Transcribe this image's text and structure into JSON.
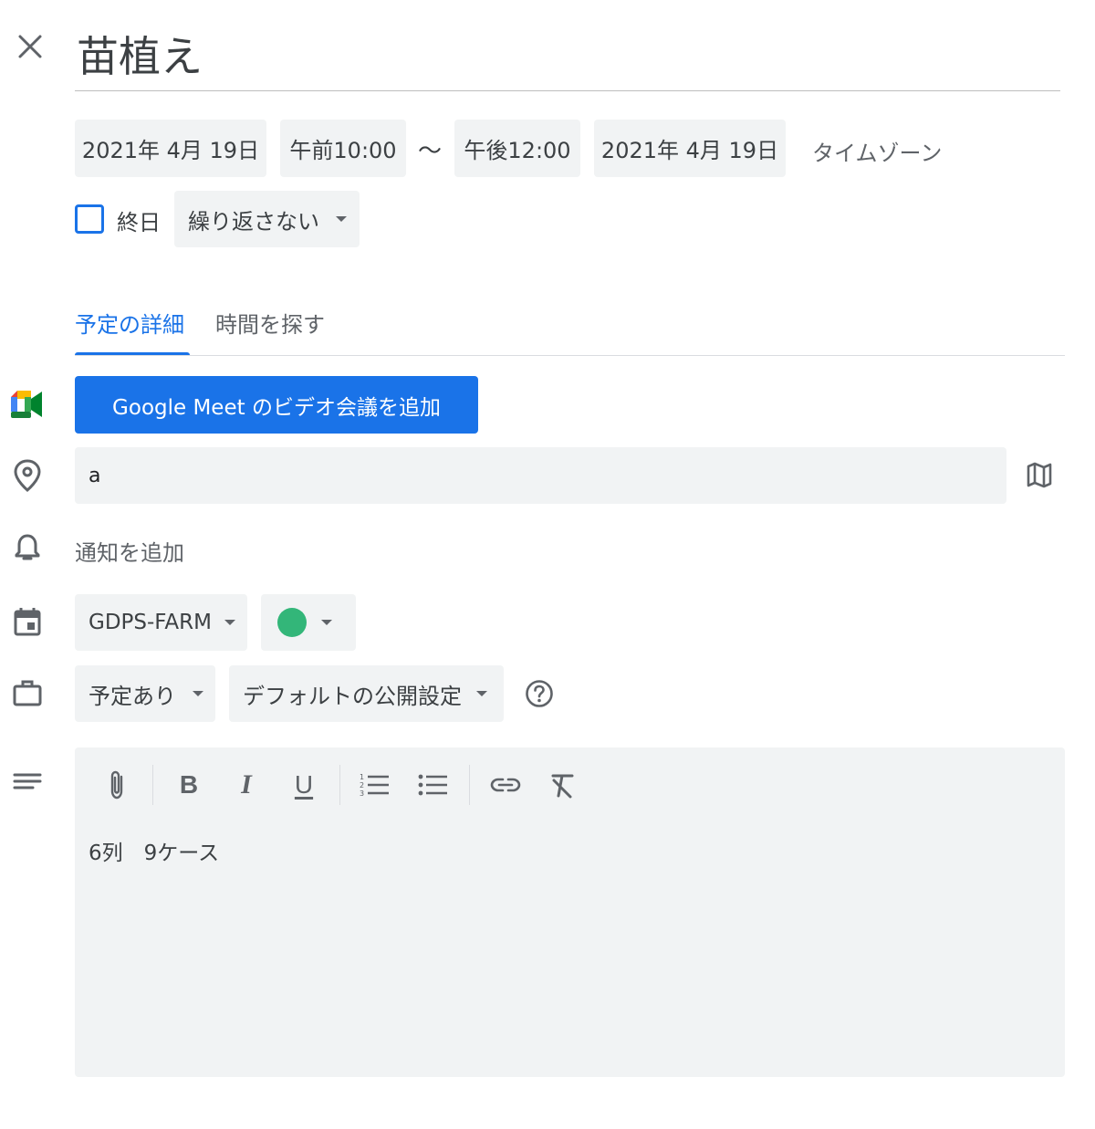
{
  "header": {
    "title": "苗植え",
    "close_icon": "close-icon"
  },
  "datetime": {
    "start_date": "2021年 4月 19日",
    "start_time": "午前10:00",
    "separator": "〜",
    "end_time": "午後12:00",
    "end_date": "2021年 4月 19日",
    "timezone_label": "タイムゾーン"
  },
  "options": {
    "all_day_label": "終日",
    "all_day_checked": false,
    "repeat_value": "繰り返さない"
  },
  "tabs": [
    {
      "label": "予定の詳細",
      "active": true
    },
    {
      "label": "時間を探す",
      "active": false
    }
  ],
  "meet": {
    "button_label": "Google Meet のビデオ会議を追加",
    "icon": "google-meet-icon"
  },
  "location": {
    "value": "a",
    "icon": "location-pin-icon",
    "map_icon": "map-icon"
  },
  "notification": {
    "label": "通知を追加",
    "icon": "bell-icon"
  },
  "calendar": {
    "name": "GDPS-FARM",
    "color": "#33b679",
    "icon": "calendar-icon"
  },
  "availability": {
    "busy_value": "予定あり",
    "visibility_value": "デフォルトの公開設定",
    "icon": "briefcase-icon",
    "help_icon": "help-circle-icon"
  },
  "description": {
    "icon": "notes-icon",
    "text": "6列　9ケース",
    "toolbar": [
      "attach-icon",
      "bold-icon",
      "italic-icon",
      "underline-icon",
      "numbered-list-icon",
      "bulleted-list-icon",
      "link-icon",
      "clear-format-icon"
    ]
  },
  "colors": {
    "accent": "#1a73e8",
    "chip_bg": "#f1f3f4",
    "text": "#3c4043",
    "muted": "#5f6368"
  }
}
